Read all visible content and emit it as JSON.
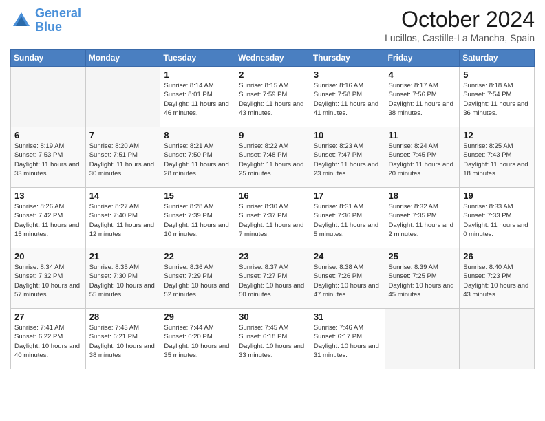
{
  "header": {
    "logo_general": "General",
    "logo_blue": "Blue",
    "month": "October 2024",
    "location": "Lucillos, Castille-La Mancha, Spain"
  },
  "days_of_week": [
    "Sunday",
    "Monday",
    "Tuesday",
    "Wednesday",
    "Thursday",
    "Friday",
    "Saturday"
  ],
  "weeks": [
    [
      {
        "day": "",
        "empty": true
      },
      {
        "day": "",
        "empty": true
      },
      {
        "day": "1",
        "sunrise": "8:14 AM",
        "sunset": "8:01 PM",
        "daylight": "11 hours and 46 minutes."
      },
      {
        "day": "2",
        "sunrise": "8:15 AM",
        "sunset": "7:59 PM",
        "daylight": "11 hours and 43 minutes."
      },
      {
        "day": "3",
        "sunrise": "8:16 AM",
        "sunset": "7:58 PM",
        "daylight": "11 hours and 41 minutes."
      },
      {
        "day": "4",
        "sunrise": "8:17 AM",
        "sunset": "7:56 PM",
        "daylight": "11 hours and 38 minutes."
      },
      {
        "day": "5",
        "sunrise": "8:18 AM",
        "sunset": "7:54 PM",
        "daylight": "11 hours and 36 minutes."
      }
    ],
    [
      {
        "day": "6",
        "sunrise": "8:19 AM",
        "sunset": "7:53 PM",
        "daylight": "11 hours and 33 minutes."
      },
      {
        "day": "7",
        "sunrise": "8:20 AM",
        "sunset": "7:51 PM",
        "daylight": "11 hours and 30 minutes."
      },
      {
        "day": "8",
        "sunrise": "8:21 AM",
        "sunset": "7:50 PM",
        "daylight": "11 hours and 28 minutes."
      },
      {
        "day": "9",
        "sunrise": "8:22 AM",
        "sunset": "7:48 PM",
        "daylight": "11 hours and 25 minutes."
      },
      {
        "day": "10",
        "sunrise": "8:23 AM",
        "sunset": "7:47 PM",
        "daylight": "11 hours and 23 minutes."
      },
      {
        "day": "11",
        "sunrise": "8:24 AM",
        "sunset": "7:45 PM",
        "daylight": "11 hours and 20 minutes."
      },
      {
        "day": "12",
        "sunrise": "8:25 AM",
        "sunset": "7:43 PM",
        "daylight": "11 hours and 18 minutes."
      }
    ],
    [
      {
        "day": "13",
        "sunrise": "8:26 AM",
        "sunset": "7:42 PM",
        "daylight": "11 hours and 15 minutes."
      },
      {
        "day": "14",
        "sunrise": "8:27 AM",
        "sunset": "7:40 PM",
        "daylight": "11 hours and 12 minutes."
      },
      {
        "day": "15",
        "sunrise": "8:28 AM",
        "sunset": "7:39 PM",
        "daylight": "11 hours and 10 minutes."
      },
      {
        "day": "16",
        "sunrise": "8:30 AM",
        "sunset": "7:37 PM",
        "daylight": "11 hours and 7 minutes."
      },
      {
        "day": "17",
        "sunrise": "8:31 AM",
        "sunset": "7:36 PM",
        "daylight": "11 hours and 5 minutes."
      },
      {
        "day": "18",
        "sunrise": "8:32 AM",
        "sunset": "7:35 PM",
        "daylight": "11 hours and 2 minutes."
      },
      {
        "day": "19",
        "sunrise": "8:33 AM",
        "sunset": "7:33 PM",
        "daylight": "11 hours and 0 minutes."
      }
    ],
    [
      {
        "day": "20",
        "sunrise": "8:34 AM",
        "sunset": "7:32 PM",
        "daylight": "10 hours and 57 minutes."
      },
      {
        "day": "21",
        "sunrise": "8:35 AM",
        "sunset": "7:30 PM",
        "daylight": "10 hours and 55 minutes."
      },
      {
        "day": "22",
        "sunrise": "8:36 AM",
        "sunset": "7:29 PM",
        "daylight": "10 hours and 52 minutes."
      },
      {
        "day": "23",
        "sunrise": "8:37 AM",
        "sunset": "7:27 PM",
        "daylight": "10 hours and 50 minutes."
      },
      {
        "day": "24",
        "sunrise": "8:38 AM",
        "sunset": "7:26 PM",
        "daylight": "10 hours and 47 minutes."
      },
      {
        "day": "25",
        "sunrise": "8:39 AM",
        "sunset": "7:25 PM",
        "daylight": "10 hours and 45 minutes."
      },
      {
        "day": "26",
        "sunrise": "8:40 AM",
        "sunset": "7:23 PM",
        "daylight": "10 hours and 43 minutes."
      }
    ],
    [
      {
        "day": "27",
        "sunrise": "7:41 AM",
        "sunset": "6:22 PM",
        "daylight": "10 hours and 40 minutes."
      },
      {
        "day": "28",
        "sunrise": "7:43 AM",
        "sunset": "6:21 PM",
        "daylight": "10 hours and 38 minutes."
      },
      {
        "day": "29",
        "sunrise": "7:44 AM",
        "sunset": "6:20 PM",
        "daylight": "10 hours and 35 minutes."
      },
      {
        "day": "30",
        "sunrise": "7:45 AM",
        "sunset": "6:18 PM",
        "daylight": "10 hours and 33 minutes."
      },
      {
        "day": "31",
        "sunrise": "7:46 AM",
        "sunset": "6:17 PM",
        "daylight": "10 hours and 31 minutes."
      },
      {
        "day": "",
        "empty": true
      },
      {
        "day": "",
        "empty": true
      }
    ]
  ]
}
